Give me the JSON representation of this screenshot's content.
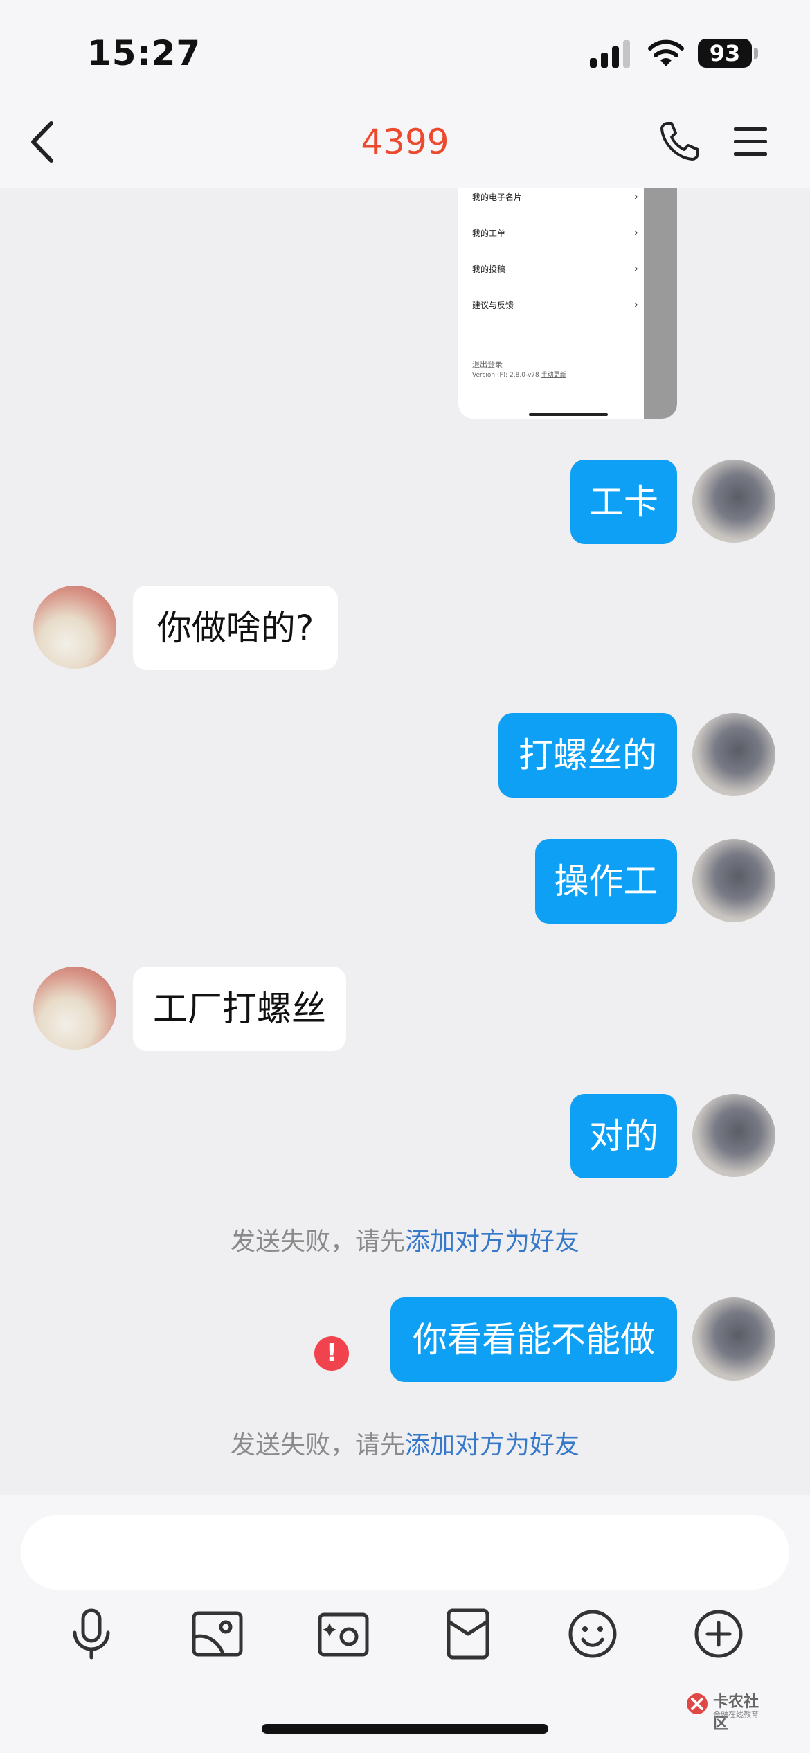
{
  "status": {
    "time": "15:27",
    "battery": "93"
  },
  "header": {
    "title": "4399"
  },
  "thumbnail": {
    "rows": [
      "我的电子名片",
      "我的工单",
      "我的投稿",
      "建议与反馈"
    ],
    "logout": "退出登录",
    "version": "Version (F): 2.8.0-v78",
    "update": "手动更新"
  },
  "messages": [
    {
      "side": "me",
      "text": "工卡"
    },
    {
      "side": "other",
      "text": "你做啥的?"
    },
    {
      "side": "me",
      "text": "打螺丝的"
    },
    {
      "side": "me",
      "text": "操作工"
    },
    {
      "side": "other",
      "text": "工厂打螺丝"
    },
    {
      "side": "me",
      "text": "对的"
    },
    {
      "side": "me",
      "text": "你看看能不能做"
    }
  ],
  "notices": [
    {
      "prefix": "发送失败，请先",
      "link": "添加对方为好友"
    },
    {
      "prefix": "发送失败，请先",
      "link": "添加对方为好友"
    }
  ],
  "error_mark": "!",
  "input": {
    "value": "",
    "placeholder": ""
  },
  "toolbar": [
    "mic-icon",
    "image-icon",
    "camera-icon",
    "red-packet-icon",
    "emoji-icon",
    "plus-icon"
  ],
  "watermark": {
    "main": "卡农社区",
    "sub": "金融在线教育"
  },
  "colors": {
    "accent": "#0ea0f5",
    "title": "#ec4a2f",
    "link": "#3678c9",
    "error": "#f0434d"
  }
}
